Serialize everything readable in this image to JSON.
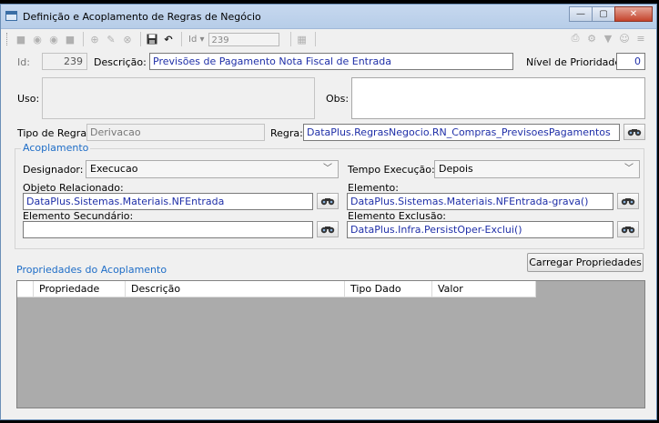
{
  "window": {
    "title": "Definição e Acoplamento de Regras de Negócio",
    "minimize_glyph": "—",
    "maximize_glyph": "▢",
    "close_glyph": "✕"
  },
  "toolbar": {
    "icons": [
      "new-icon",
      "first-icon",
      "previous-icon",
      "next-icon",
      "add-icon",
      "edit-icon",
      "delete-icon",
      "save-icon",
      "undo-icon"
    ],
    "id_label": "Id",
    "id_dropdown_glyph": "▾",
    "id_value": "239"
  },
  "header": {
    "id_label": "Id:",
    "id_value": "239",
    "descricao_label": "Descrição:",
    "descricao_value": "Previsões de Pagamento Nota Fiscal de Entrada",
    "prioridade_label": "Nível de Prioridade:",
    "prioridade_value": "0"
  },
  "uso_label": "Uso:",
  "obs_label": "Obs:",
  "tipo_regra_label": "Tipo de Regra:",
  "tipo_regra_value": "Derivacao",
  "regra_label": "Regra:",
  "regra_value": "DataPlus.RegrasNegocio.RN_Compras_PrevisoesPagamentos",
  "acoplamento": {
    "title": "Acoplamento",
    "designador_label": "Designador:",
    "designador_value": "Execucao",
    "tempo_label": "Tempo Execução:",
    "tempo_value": "Depois",
    "objeto_label": "Objeto Relacionado:",
    "objeto_value": "DataPlus.Sistemas.Materiais.NFEntrada",
    "elemento_label": "Elemento:",
    "elemento_value": "DataPlus.Sistemas.Materiais.NFEntrada-grava()",
    "secundario_label": "Elemento Secundário:",
    "secundario_value": "",
    "exclusao_label": "Elemento Exclusão:",
    "exclusao_value": "DataPlus.Infra.PersistOper-Exclui()"
  },
  "carregar_button": "Carregar Propriedades",
  "propriedades_title": "Propriedades do Acoplamento",
  "grid_columns": [
    "Propriedade",
    "Descrição",
    "Tipo Dado",
    "Valor"
  ],
  "colors": {
    "link_text": "#1f2fa8",
    "group_title": "#1e6dc7",
    "grid_bg": "#ababab"
  }
}
